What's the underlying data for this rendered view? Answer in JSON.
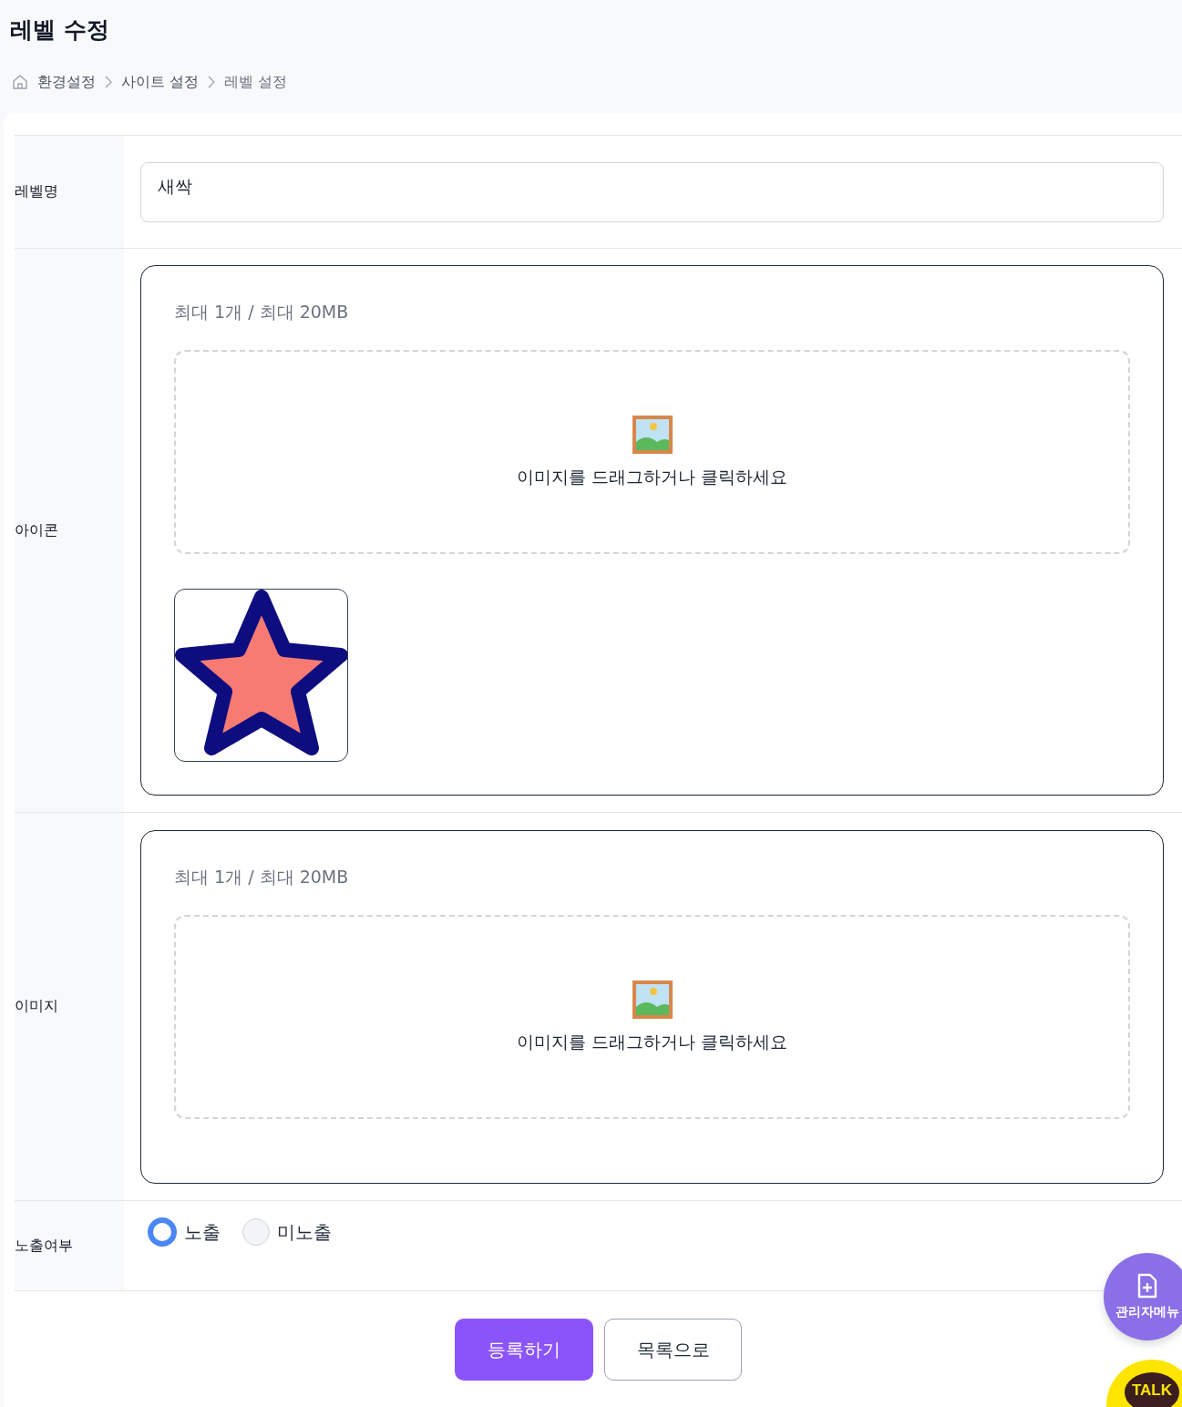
{
  "page": {
    "title": "레벨 수정"
  },
  "breadcrumb": [
    {
      "label": "환경설정"
    },
    {
      "label": "사이트 설정"
    },
    {
      "label": "레벨 설정"
    }
  ],
  "form": {
    "rows": [
      {
        "kind": "text",
        "label": "레벨명",
        "value": "새싹"
      },
      {
        "kind": "upload",
        "label": "아이콘",
        "limit": "최대 1개 / 최대 20MB",
        "prompt": "이미지를 드래그하거나 클릭하세요",
        "preview": true
      },
      {
        "kind": "upload",
        "label": "이미지",
        "limit": "최대 1개 / 최대 20MB",
        "prompt": "이미지를 드래그하거나 클릭하세요",
        "preview": false
      },
      {
        "kind": "radio",
        "label": "노출여부",
        "options": [
          {
            "label": "노출",
            "selected": true
          },
          {
            "label": "미노출",
            "selected": false
          }
        ]
      }
    ]
  },
  "buttons": [
    {
      "label": "등록하기",
      "primary": true
    },
    {
      "label": "목록으로",
      "primary": false
    }
  ],
  "floating": {
    "manual": "관리자메뉴",
    "talk": "TALK"
  }
}
